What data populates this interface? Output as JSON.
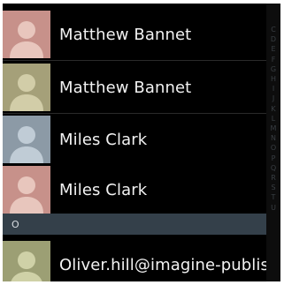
{
  "contacts": [
    {
      "name": "Matthew Bannet",
      "avatar_bg": "#c7918a",
      "avatar_fg": "#e8c6bd"
    },
    {
      "name": "Matthew Bannet",
      "avatar_bg": "#a5a079",
      "avatar_fg": "#d2cda8"
    },
    {
      "name": "Miles Clark",
      "avatar_bg": "#8c9aa6",
      "avatar_fg": "#c0ccd6"
    },
    {
      "name": "Miles Clark",
      "avatar_bg": "#c7918a",
      "avatar_fg": "#e8c6bd"
    },
    {
      "name": "Oliver.hill@imagine-publishing",
      "avatar_bg": "#9c9f74",
      "avatar_fg": "#cfd1a7"
    }
  ],
  "section_header": "O",
  "index_letters": [
    "C",
    "D",
    "E",
    "F",
    "G",
    "H",
    "I",
    "J",
    "K",
    "L",
    "M",
    "N",
    "O",
    "P",
    "Q",
    "R",
    "S",
    "T",
    "U"
  ]
}
